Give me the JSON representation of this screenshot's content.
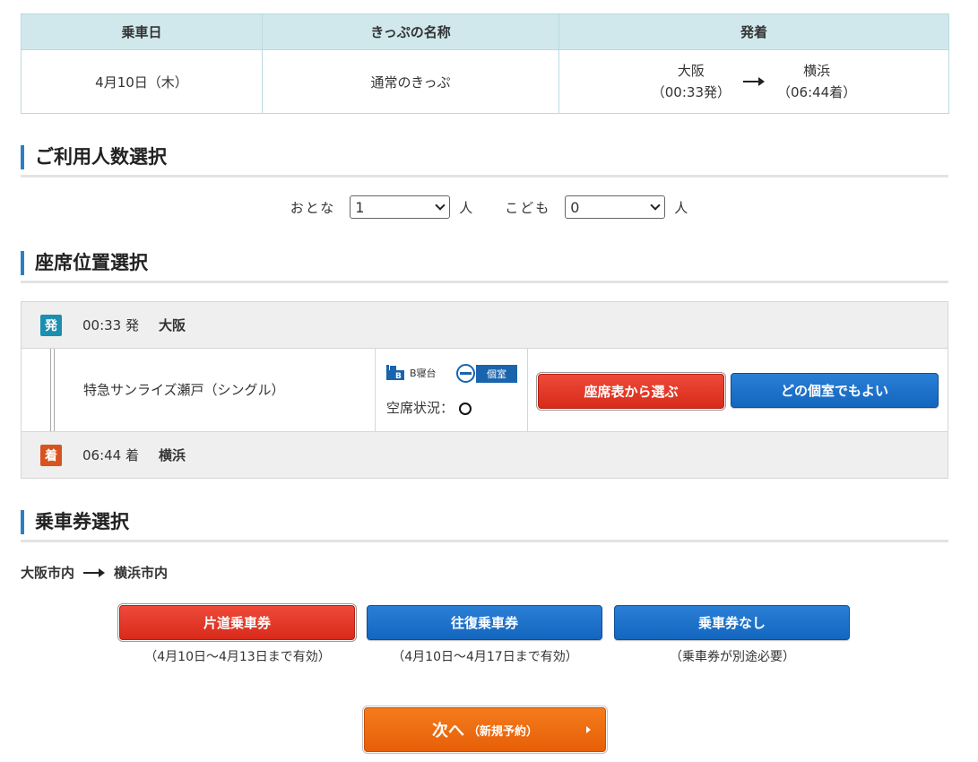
{
  "ticket_table": {
    "headers": [
      "乗車日",
      "きっぷの名称",
      "発着"
    ],
    "date": "4月10日（木）",
    "ticket_name": "通常のきっぷ",
    "from_station": "大阪",
    "from_time": "（00:33発）",
    "to_station": "横浜",
    "to_time": "（06:44着）"
  },
  "passengers": {
    "heading": "ご利用人数選択",
    "adult_label": "おとな",
    "adult_value": "1",
    "child_label": "こども",
    "child_value": "0",
    "unit": "人"
  },
  "seat": {
    "heading": "座席位置選択",
    "departure": {
      "badge": "発",
      "badge_color": "#1a8fb0",
      "time": "00:33 発",
      "station": "大阪"
    },
    "arrival": {
      "badge": "着",
      "badge_color": "#d9531e",
      "time": "06:44 着",
      "station": "横浜"
    },
    "train_name": "特急サンライズ瀬戸（シングル）",
    "bed_type": "B寝台",
    "room_type": "個室",
    "vacancy_label": "空席状況：",
    "choose_from_map": "座席表から選ぶ",
    "any_room": "どの個室でもよい"
  },
  "fare": {
    "heading": "乗車券選択",
    "from": "大阪市内",
    "to": "横浜市内",
    "options": [
      {
        "label": "片道乗車券",
        "note": "（4月10日～4月13日まで有効）"
      },
      {
        "label": "往復乗車券",
        "note": "（4月10日～4月17日まで有効）"
      },
      {
        "label": "乗車券なし",
        "note": "（乗車券が別途必要）"
      }
    ]
  },
  "next_button": {
    "main": "次へ",
    "sub": "（新規予約）"
  },
  "colors": {
    "accent_blue": "#1466bf",
    "accent_red": "#d82a1a",
    "accent_orange": "#e75f08",
    "table_header": "#d0e8ec"
  }
}
